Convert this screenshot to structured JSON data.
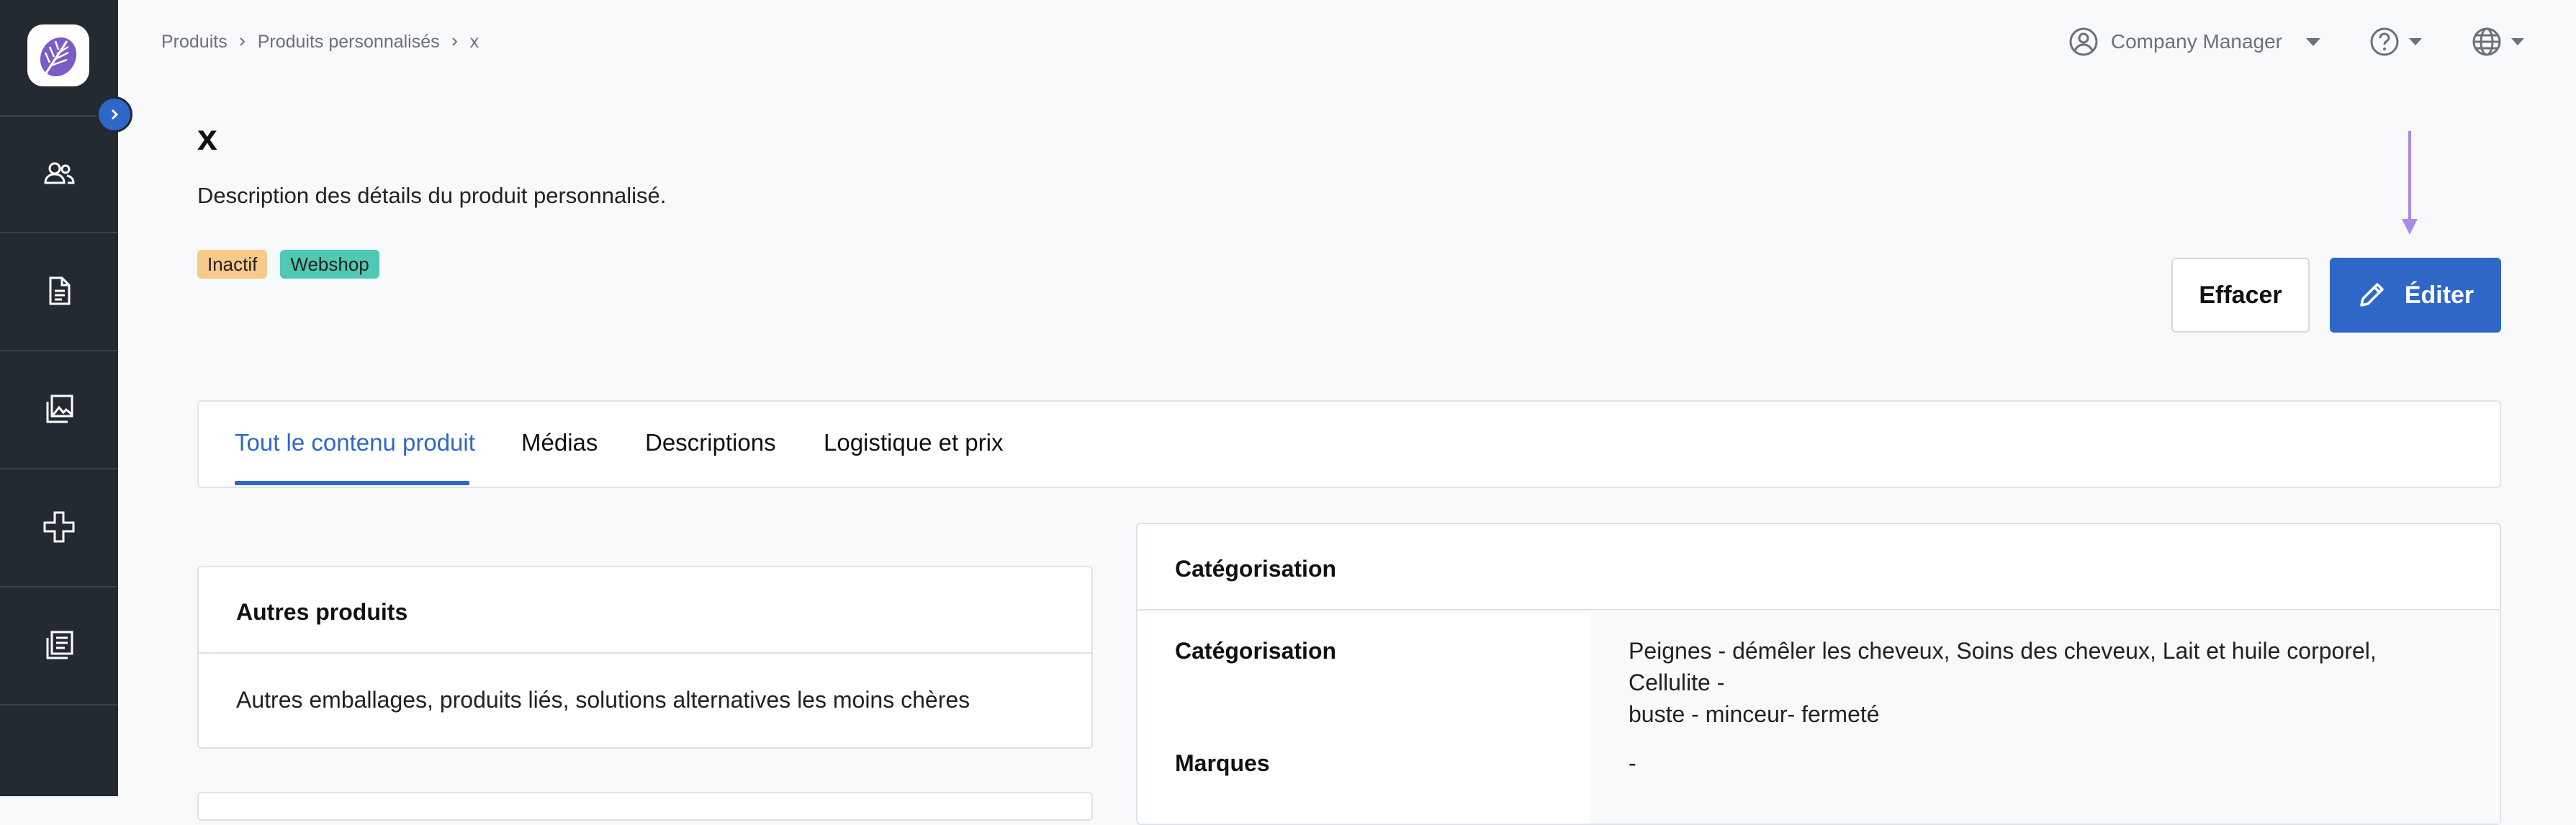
{
  "breadcrumb": [
    "Produits",
    "Produits personnalisés",
    "x"
  ],
  "topbar": {
    "user_label": "Company Manager",
    "icons": [
      "user-circle-icon",
      "help-circle-icon",
      "globe-icon",
      "caret-down-icon"
    ]
  },
  "header": {
    "title": "x",
    "description": "Description des détails du produit personnalisé.",
    "badges": [
      {
        "label": "Inactif",
        "color": "#f7c98a"
      },
      {
        "label": "Webshop",
        "color": "#4fc9b3"
      }
    ]
  },
  "actions": {
    "clear_label": "Effacer",
    "edit_label": "Éditer",
    "accent_color": "#2f67c9"
  },
  "tabs": [
    {
      "label": "Tout le contenu produit",
      "active": true
    },
    {
      "label": "Médias",
      "active": false
    },
    {
      "label": "Descriptions",
      "active": false
    },
    {
      "label": "Logistique et prix",
      "active": false
    }
  ],
  "other_products": {
    "title": "Autres produits",
    "text": "Autres emballages, produits liés, solutions alternatives les moins chères"
  },
  "categorization": {
    "title": "Catégorisation",
    "rows": [
      {
        "label": "Catégorisation",
        "value_line1": "Peignes - démêler les cheveux, Soins des cheveux, Lait et huile corporel, Cellulite -",
        "value_line2": "buste - minceur- fermeté"
      },
      {
        "label": "Marques",
        "value_line1": "-",
        "value_line2": ""
      }
    ]
  },
  "sidebar": {
    "items": [
      "users-icon",
      "document-icon",
      "images-icon",
      "plus-outline-icon",
      "catalog-icon"
    ]
  }
}
